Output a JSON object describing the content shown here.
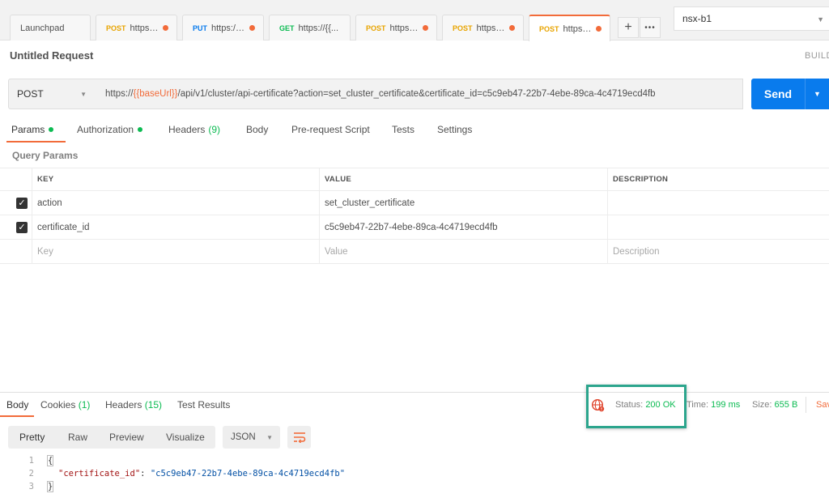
{
  "tabs": [
    {
      "method": "",
      "url": "Launchpad",
      "dot": false
    },
    {
      "method": "POST",
      "url": "https://{{...",
      "dot": true
    },
    {
      "method": "PUT",
      "url": "https://{{...",
      "dot": true
    },
    {
      "method": "GET",
      "url": "https://{{...",
      "dot": false
    },
    {
      "method": "POST",
      "url": "https://{{...",
      "dot": true
    },
    {
      "method": "POST",
      "url": "https://{{...",
      "dot": true
    },
    {
      "method": "POST",
      "url": "https://{{...",
      "dot": true
    }
  ],
  "tab_actions": {
    "new": "+",
    "more": "•••"
  },
  "environment": {
    "selected": "nsx-b1"
  },
  "request": {
    "title": "Untitled Request",
    "build_label": "BUILD",
    "method": "POST",
    "url_prefix": "https://",
    "url_variable": "{{baseUrl}}",
    "url_rest": "/api/v1/cluster/api-certificate?action=set_cluster_certificate&certificate_id=c5c9eb47-22b7-4ebe-89ca-4c4719ecd4fb",
    "send_label": "Send"
  },
  "request_tabs": [
    {
      "label": "Params",
      "count": "",
      "dot": true
    },
    {
      "label": "Authorization",
      "count": "",
      "dot": true
    },
    {
      "label": "Headers",
      "count": "(9)",
      "dot": false
    },
    {
      "label": "Body",
      "count": "",
      "dot": false
    },
    {
      "label": "Pre-request Script",
      "count": "",
      "dot": false
    },
    {
      "label": "Tests",
      "count": "",
      "dot": false
    },
    {
      "label": "Settings",
      "count": "",
      "dot": false
    }
  ],
  "query_params": {
    "title": "Query Params",
    "headers": {
      "key": "KEY",
      "value": "VALUE",
      "description": "DESCRIPTION"
    },
    "rows": [
      {
        "checked": true,
        "key": "action",
        "value": "set_cluster_certificate",
        "description": ""
      },
      {
        "checked": true,
        "key": "certificate_id",
        "value": "c5c9eb47-22b7-4ebe-89ca-4c4719ecd4fb",
        "description": ""
      }
    ],
    "placeholder": {
      "key": "Key",
      "value": "Value",
      "description": "Description"
    }
  },
  "response": {
    "tabs": [
      {
        "label": "Body",
        "count": ""
      },
      {
        "label": "Cookies",
        "count": "(1)"
      },
      {
        "label": "Headers",
        "count": "(15)"
      },
      {
        "label": "Test Results",
        "count": ""
      }
    ],
    "status_label": "Status:",
    "status_value": "200 OK",
    "time_label": "Time:",
    "time_value": "199 ms",
    "size_label": "Size:",
    "size_value": "655 B",
    "save_label": "Sav",
    "formats": [
      "Pretty",
      "Raw",
      "Preview",
      "Visualize"
    ],
    "language": "JSON",
    "body_lines": [
      {
        "n": "1",
        "text": "{"
      },
      {
        "n": "2",
        "key": "\"certificate_id\"",
        "value": "\"c5c9eb47-22b7-4ebe-89ca-4c4719ecd4fb\""
      },
      {
        "n": "3",
        "text": "}"
      }
    ]
  }
}
